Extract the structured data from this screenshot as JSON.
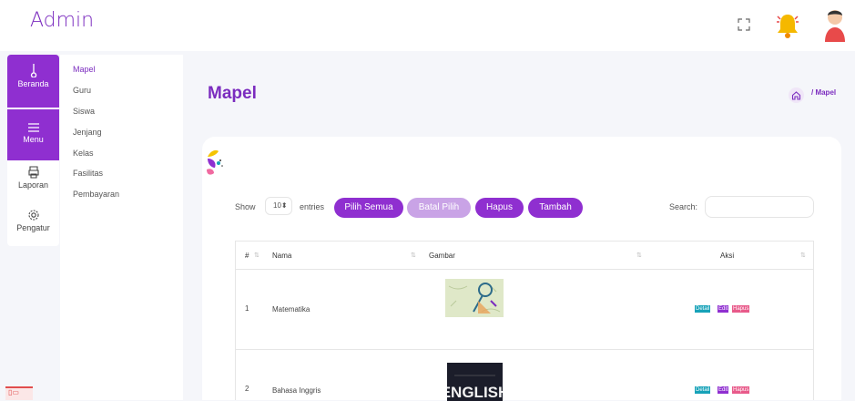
{
  "brand": "Admin",
  "iconbar": {
    "beranda": "Beranda",
    "menu": "Menu",
    "laporan": "Laporan",
    "pengatur": "Pengatur"
  },
  "submenu": [
    "Mapel",
    "Guru",
    "Siswa",
    "Jenjang",
    "Kelas",
    "Fasilitas",
    "Pembayaran"
  ],
  "page": {
    "title": "Mapel",
    "breadcrumb": "/ Mapel"
  },
  "table_controls": {
    "show": "Show",
    "entries_value": "10",
    "entries": "entries",
    "pilih_semua": "Pilih Semua",
    "batal_pilih": "Batal Pilih",
    "hapus": "Hapus",
    "tambah": "Tambah",
    "search_label": "Search:"
  },
  "table": {
    "headers": [
      "#",
      "Nama",
      "Gambar",
      "Aksi"
    ],
    "rows": [
      {
        "no": "1",
        "nama": "Matematika",
        "image_label": "",
        "actions": [
          "Detail",
          "Edit",
          "Hapus"
        ]
      },
      {
        "no": "2",
        "nama": "Bahasa Inggris",
        "image_label": "ENGLISH",
        "actions": [
          "Detail",
          "Edit",
          "Hapus"
        ]
      }
    ]
  },
  "colors": {
    "primary": "#8f2fd0",
    "primary_light": "#c9a3e6",
    "detail": "#17a2b8",
    "hapus": "#e85a8a"
  },
  "icons": [
    "expand-icon",
    "bell-icon",
    "avatar",
    "thermometer-icon",
    "hamburger-icon",
    "printer-icon",
    "gear-icon",
    "home-icon"
  ]
}
